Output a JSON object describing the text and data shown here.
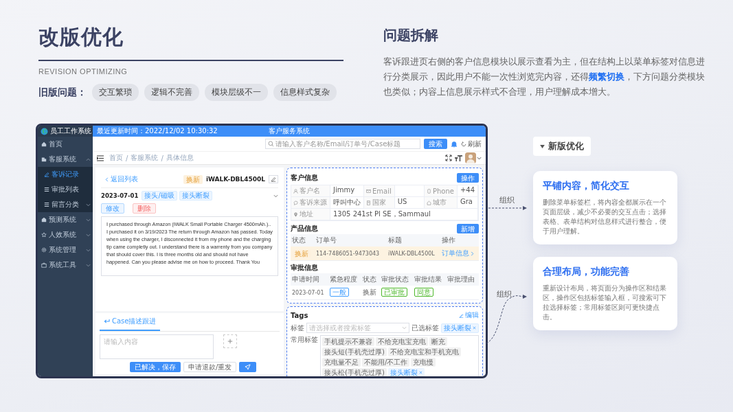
{
  "slide": {
    "title": "改版优化",
    "subtitle": "REVISION OPTIMIZING",
    "issues_label": "旧版问题：",
    "issues": [
      "交互繁琐",
      "逻辑不完善",
      "模块层级不一",
      "信息样式复杂"
    ]
  },
  "analysis": {
    "title": "问题拆解",
    "text": "客诉跟进页右侧的客户信息模块以展示查看为主，但在结构上以菜单标签对信息进行分类展示，因此用户不能一次性浏览完内容，还得**频繁切换**，下方问题分类模块也类似；内容上信息展示样式不合理，用户理解成本增大。"
  },
  "app": {
    "brand": "员工工作系统",
    "sidebar": [
      {
        "label": "首页",
        "selected": false
      },
      {
        "label": "客服系统",
        "selected": false,
        "expanded": true,
        "children": [
          {
            "label": "客诉记录",
            "selected": true
          },
          {
            "label": "审批列表",
            "selected": false
          },
          {
            "label": "留言分类",
            "selected": false,
            "expanded": false
          }
        ]
      },
      {
        "label": "预测系统",
        "selected": false,
        "expanded": false
      },
      {
        "label": "人效系统",
        "selected": false,
        "expanded": false
      },
      {
        "label": "系统管理",
        "selected": false,
        "expanded": false
      },
      {
        "label": "系统工具",
        "selected": false,
        "expanded": false
      }
    ],
    "updated": "最近更新时间：2022/12/02 10:30:32",
    "title": "客户服务系统",
    "search": {
      "placeholder": "请输入客户名称/Email/订单号/Case标题",
      "button": "搜索"
    },
    "refresh": "刷新",
    "breadcrumb": [
      "首页",
      "客服系统",
      "具体信息"
    ],
    "breadcrumb_separator": "/",
    "case": {
      "back": "返回列表",
      "status": "换新",
      "product": "iWALK-DBL4500L",
      "date": "2023-07-01",
      "tags": [
        "接头/磁吸",
        "接头断裂"
      ],
      "actions": [
        {
          "label": "修改",
          "kind": "edit"
        },
        {
          "label": "删除",
          "kind": "danger"
        }
      ],
      "description": "I purchased through Amazon (iWALK Small Portable Charger 4500mAh.).. I purchased it on 3/19/2023 The return through Amazon has passed. Today when using the charger, I disconnected it from my phone and the charging tip came completly out. I understand there is a warrenty from you company that should cover this. I is three months old and should not have happened. Can you please advise me on how to proceed. Thank You"
    },
    "followup": {
      "tab": {
        "label": "Case描述跟进",
        "selected": true
      },
      "placeholder": "请输入内容",
      "buttons": [
        {
          "label": "已解决，保存",
          "kind": "primary"
        },
        {
          "label": "申请退款/重发",
          "kind": "default"
        }
      ]
    },
    "customer": {
      "title": "客户信息",
      "button": "操作",
      "fields": [
        {
          "label": "客户名",
          "value": "Jimmy"
        },
        {
          "label": "Email"
        },
        {
          "label": "Phone",
          "value": "+44"
        },
        {
          "label": "客诉来源",
          "value": "呼叫中心"
        },
        {
          "label": "国家",
          "value": "US"
        },
        {
          "label": "城市",
          "value": "Gra"
        },
        {
          "label": "地址",
          "value": "1305 241st Pl SE，Sammaul"
        }
      ]
    },
    "products": {
      "title": "产品信息",
      "button": "新增",
      "columns": [
        "状态",
        "订单号",
        "标题",
        "操作"
      ],
      "rows": [
        {
          "selected": true,
          "cells": [
            {
              "text": "换新",
              "kind": "badge"
            },
            {
              "text": "114-7486051-9473043"
            },
            {
              "text": "iWALK-DBL4500L"
            },
            {
              "text": "订单信息",
              "kind": "link"
            }
          ]
        }
      ]
    },
    "approvals": {
      "title": "审批信息",
      "columns": [
        "申请时间",
        "紧急程度",
        "状态",
        "审批状态",
        "审批结果",
        "审批理由"
      ],
      "rows": [
        {
          "cells": [
            {
              "text": "2023-07-01"
            },
            {
              "text": "一般",
              "kind": "tag",
              "color": "#409eff"
            },
            {
              "text": "换新"
            },
            {
              "text": "已审批",
              "kind": "tag",
              "color": "#4cb82a"
            },
            {
              "text": "同意",
              "kind": "tag",
              "color": "#4cb82a"
            }
          ]
        }
      ]
    },
    "tags": {
      "title": "Tags",
      "edit": "编辑",
      "field_label": "标签",
      "placeholder": "请选择或者搜索标签",
      "chosen_label": "已选标签",
      "chosen": [
        "接头断裂"
      ],
      "common_label": "常用标签",
      "common": [
        {
          "text": "手机提示不兼容",
          "selected": false
        },
        {
          "text": "不给充电宝充电",
          "selected": false
        },
        {
          "text": "断充",
          "selected": false
        },
        {
          "text": "接头短(手机壳过厚)",
          "selected": false
        },
        {
          "text": "不给充电宝和手机充电",
          "selected": false
        },
        {
          "text": "充电量不足",
          "selected": false
        },
        {
          "text": "不能用/不工作",
          "selected": false
        },
        {
          "text": "充电慢",
          "selected": false
        },
        {
          "text": "接头松(手机壳过厚)",
          "selected": false
        },
        {
          "text": "接头断裂",
          "selected": true
        }
      ]
    }
  },
  "new_version": {
    "label": "新版优化",
    "cards": [
      {
        "title": "平铺内容，简化交互",
        "text": "删除菜单标签栏，将内容全都展示在一个页面层级，减少不必要的交互点击；选择表格、表单结构对信息样式进行整合，便于用户理解。"
      },
      {
        "title": "合理布局，功能完善",
        "text": "重新设计布局，将页面分为操作区和结果区，操作区包括标签输入框，可搜索可下拉选择标签；常用标签区则可更快捷点击。"
      }
    ]
  },
  "connectors": [
    {
      "label": "组织"
    },
    {
      "label": "组织"
    }
  ]
}
